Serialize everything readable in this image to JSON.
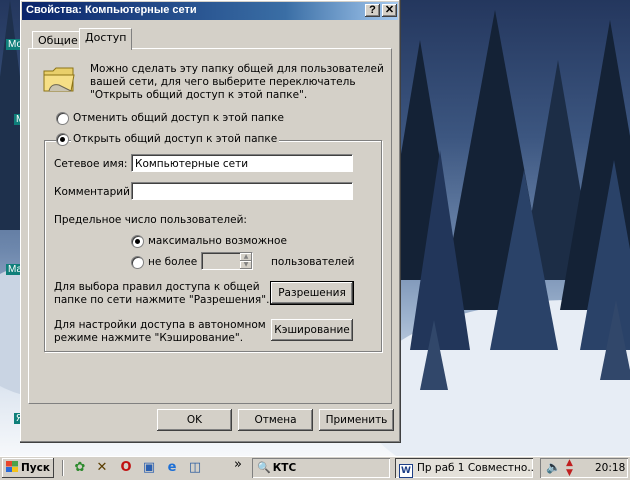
{
  "desktop": {
    "icons": [
      "Мо",
      "М",
      "Ма",
      "Я"
    ]
  },
  "dialog": {
    "title": "Свойства: Компьютерные сети",
    "help_btn": "?",
    "close_btn": "✕",
    "tabs": [
      {
        "label": "Общие",
        "active": false
      },
      {
        "label": "Доступ",
        "active": true
      }
    ],
    "info_text_lines": [
      "Можно сделать эту папку общей для пользователей",
      "вашей сети, для чего выберите переключатель",
      "\"Открыть общий доступ к этой папке\"."
    ],
    "radio_no_share": {
      "label": "Отменить общий доступ к этой папке",
      "checked": false
    },
    "radio_share": {
      "label": "Открыть общий доступ к этой папке",
      "checked": true
    },
    "share_name": {
      "label": "Сетевое имя:",
      "value": "Компьютерные сети"
    },
    "comment": {
      "label": "Комментарий:",
      "value": ""
    },
    "user_limit": {
      "label": "Предельное число пользователей:",
      "max_allowed": {
        "label": "максимально возможное",
        "checked": true
      },
      "allow_up_to": {
        "label": "не более",
        "checked": false,
        "suffix": "пользователей",
        "value": ""
      }
    },
    "permissions": {
      "text_lines": [
        "Для выбора правил доступа к общей",
        "папке по сети нажмите \"Разрешения\"."
      ],
      "button": "Разрешения"
    },
    "caching": {
      "text_lines": [
        "Для настройки доступа в автономном",
        "режиме нажмите \"Кэширование\"."
      ],
      "button": "Кэширование"
    },
    "footer": {
      "ok": "OK",
      "cancel": "Отмена",
      "apply": "Применить"
    }
  },
  "taskbar": {
    "start_label": "Пуск",
    "more_chevron": "»",
    "address_label": "КТС",
    "task_label": "Пр раб 1 Совместно...",
    "clock": "20:18"
  },
  "colors": {
    "title_active_start": "#0a246a",
    "title_active_end": "#a6caf0",
    "face": "#d4d0c8"
  }
}
